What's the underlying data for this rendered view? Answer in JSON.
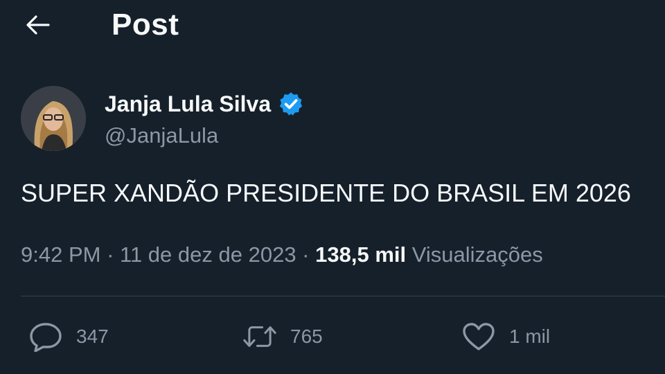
{
  "header": {
    "title": "Post",
    "back_icon": "arrow-left-icon"
  },
  "author": {
    "name": "Janja Lula Silva",
    "handle": "@JanjaLula",
    "verified_icon": "verified-badge-icon",
    "verified_color": "#1d9bf0"
  },
  "tweet": {
    "text": "SUPER XANDÃO PRESIDENTE DO BRASIL EM 2026",
    "time": "9:42 PM",
    "separator": " · ",
    "date": "11 de dez de 2023",
    "views_count": "138,5 mil",
    "views_label": "Visualizações"
  },
  "actions": {
    "reply": {
      "icon": "reply-icon",
      "count": "347"
    },
    "retweet": {
      "icon": "retweet-icon",
      "count": "765"
    },
    "like": {
      "icon": "heart-icon",
      "count": "1 mil"
    }
  },
  "colors": {
    "background": "#15202b",
    "text_primary": "#f7f9f9",
    "text_secondary": "#8b98a5",
    "divider": "#38444d"
  }
}
